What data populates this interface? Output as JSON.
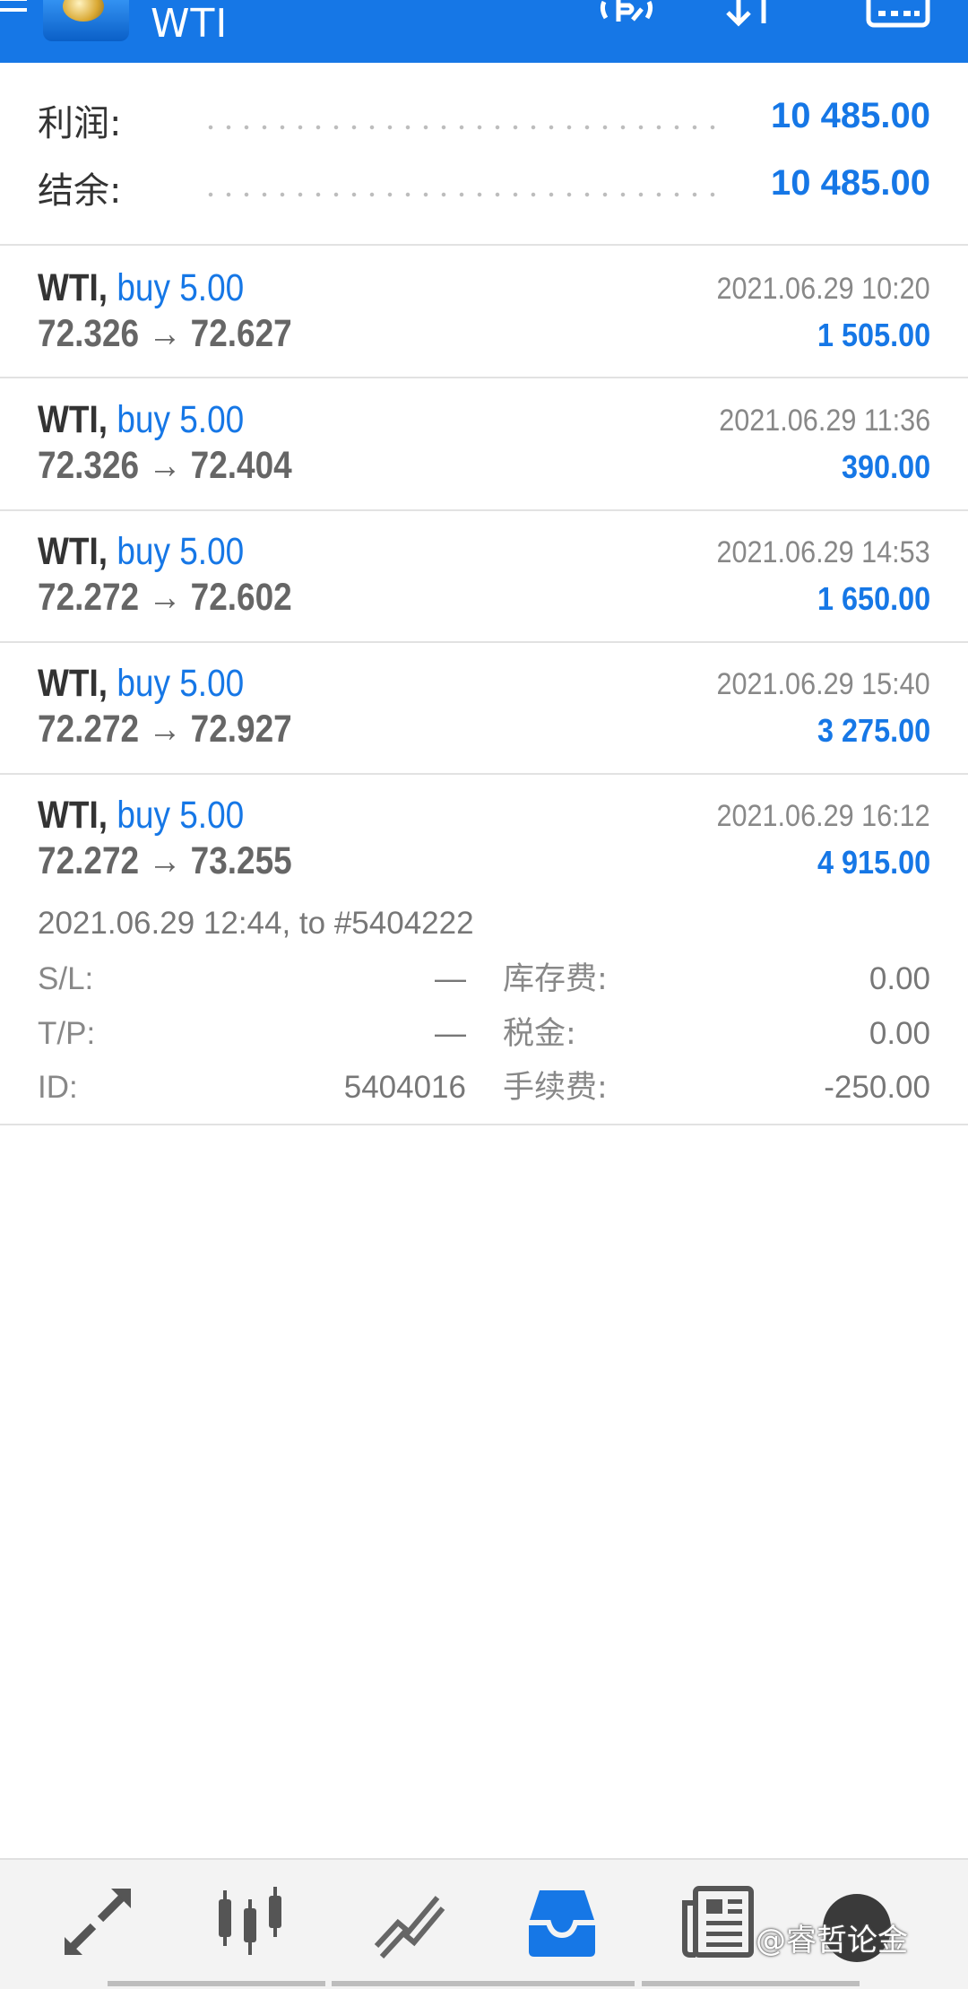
{
  "header": {
    "title": "WTI",
    "icons": [
      "menu-icon",
      "app-logo",
      "trade-icon",
      "sort-icon",
      "calendar-icon"
    ]
  },
  "summary": {
    "profit_label": "利润:",
    "profit_value": "10 485.00",
    "balance_label": "结余:",
    "balance_value": "10 485.00"
  },
  "deals": [
    {
      "symbol": "WTI,",
      "type": "buy 5.00",
      "prices": "72.326 → 72.627",
      "time": "2021.06.29 10:20",
      "profit": "1 505.00"
    },
    {
      "symbol": "WTI,",
      "type": "buy 5.00",
      "prices": "72.326 → 72.404",
      "time": "2021.06.29 11:36",
      "profit": "390.00"
    },
    {
      "symbol": "WTI,",
      "type": "buy 5.00",
      "prices": "72.272 → 72.602",
      "time": "2021.06.29 14:53",
      "profit": "1 650.00"
    },
    {
      "symbol": "WTI,",
      "type": "buy 5.00",
      "prices": "72.272 → 72.927",
      "time": "2021.06.29 15:40",
      "profit": "3 275.00"
    },
    {
      "symbol": "WTI,",
      "type": "buy 5.00",
      "prices": "72.272 → 73.255",
      "time": "2021.06.29 16:12",
      "profit": "4 915.00"
    }
  ],
  "details": {
    "open_info": "2021.06.29 12:44, to #5404222",
    "sl_label": "S/L:",
    "sl_value": "—",
    "tp_label": "T/P:",
    "tp_value": "—",
    "id_label": "ID:",
    "id_value": "5404016",
    "swap_label": "库存费:",
    "swap_value": "0.00",
    "tax_label": "税金:",
    "tax_value": "0.00",
    "commission_label": "手续费:",
    "commission_value": "-250.00"
  },
  "bottom_nav": {
    "items": [
      "quotes-icon",
      "chart-icon",
      "trade-icon",
      "history-icon",
      "news-icon",
      "chat-icon"
    ],
    "active": "history-icon",
    "watermark": "@睿哲论金"
  },
  "colors": {
    "accent": "#1677e6",
    "text": "#333333",
    "muted": "#888888"
  }
}
